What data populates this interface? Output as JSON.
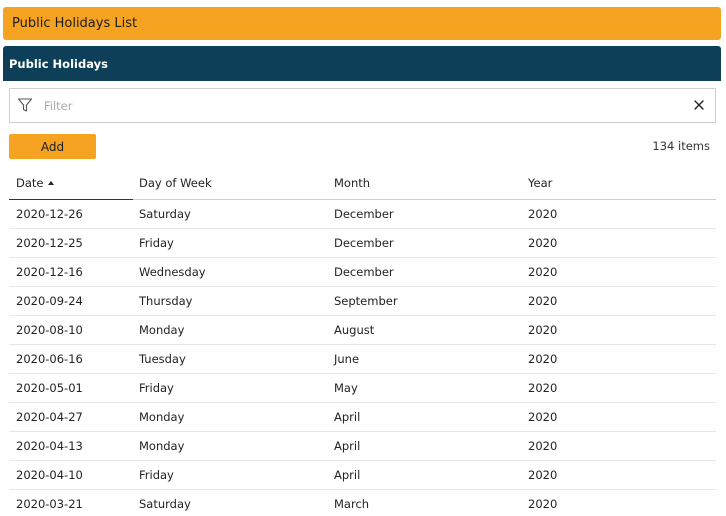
{
  "title_bar": {
    "title": "Public Holidays List"
  },
  "panel": {
    "header": "Public Holidays"
  },
  "filter": {
    "placeholder": "Filter",
    "value": ""
  },
  "toolbar": {
    "add_label": "Add",
    "items_count": "134 items"
  },
  "grid": {
    "columns": [
      {
        "label": "Date",
        "sorted": "ascending"
      },
      {
        "label": "Day of Week"
      },
      {
        "label": "Month"
      },
      {
        "label": "Year"
      }
    ],
    "rows": [
      [
        "2020-12-26",
        "Saturday",
        "December",
        "2020"
      ],
      [
        "2020-12-25",
        "Friday",
        "December",
        "2020"
      ],
      [
        "2020-12-16",
        "Wednesday",
        "December",
        "2020"
      ],
      [
        "2020-09-24",
        "Thursday",
        "September",
        "2020"
      ],
      [
        "2020-08-10",
        "Monday",
        "August",
        "2020"
      ],
      [
        "2020-06-16",
        "Tuesday",
        "June",
        "2020"
      ],
      [
        "2020-05-01",
        "Friday",
        "May",
        "2020"
      ],
      [
        "2020-04-27",
        "Monday",
        "April",
        "2020"
      ],
      [
        "2020-04-13",
        "Monday",
        "April",
        "2020"
      ],
      [
        "2020-04-10",
        "Friday",
        "April",
        "2020"
      ],
      [
        "2020-03-21",
        "Saturday",
        "March",
        "2020"
      ]
    ]
  },
  "icons": {
    "filter": "filter-funnel-icon",
    "clear": "close-x-icon",
    "sort": "sort-ascending-triangle-icon"
  },
  "colors": {
    "title_bar": "#f5a321",
    "panel_header": "#0d3f58",
    "add_button": "#f5a321"
  }
}
